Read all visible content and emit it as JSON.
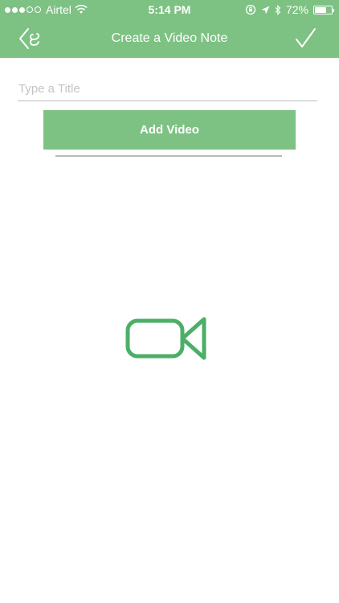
{
  "status_bar": {
    "carrier": "Airtel",
    "time": "5:14 PM",
    "battery": "72%",
    "battery_level": 0.72,
    "signal_bars_filled": 3,
    "signal_bars_total": 5,
    "icons": [
      "wifi-icon",
      "rotation-lock-icon",
      "location-arrow-icon",
      "bluetooth-icon",
      "battery-icon"
    ]
  },
  "nav": {
    "title": "Create a Video Note",
    "back_icon": "back-chevron-icon",
    "done_icon": "checkmark-icon"
  },
  "form": {
    "title_placeholder": "Type a Title",
    "title_value": "",
    "add_video_label": "Add Video"
  },
  "center_icon": "video-camera-icon",
  "colors": {
    "accent": "#7dc283",
    "icon_green": "#4caf68",
    "divider": "#b9b9b9",
    "placeholder": "#c4c4c4"
  }
}
